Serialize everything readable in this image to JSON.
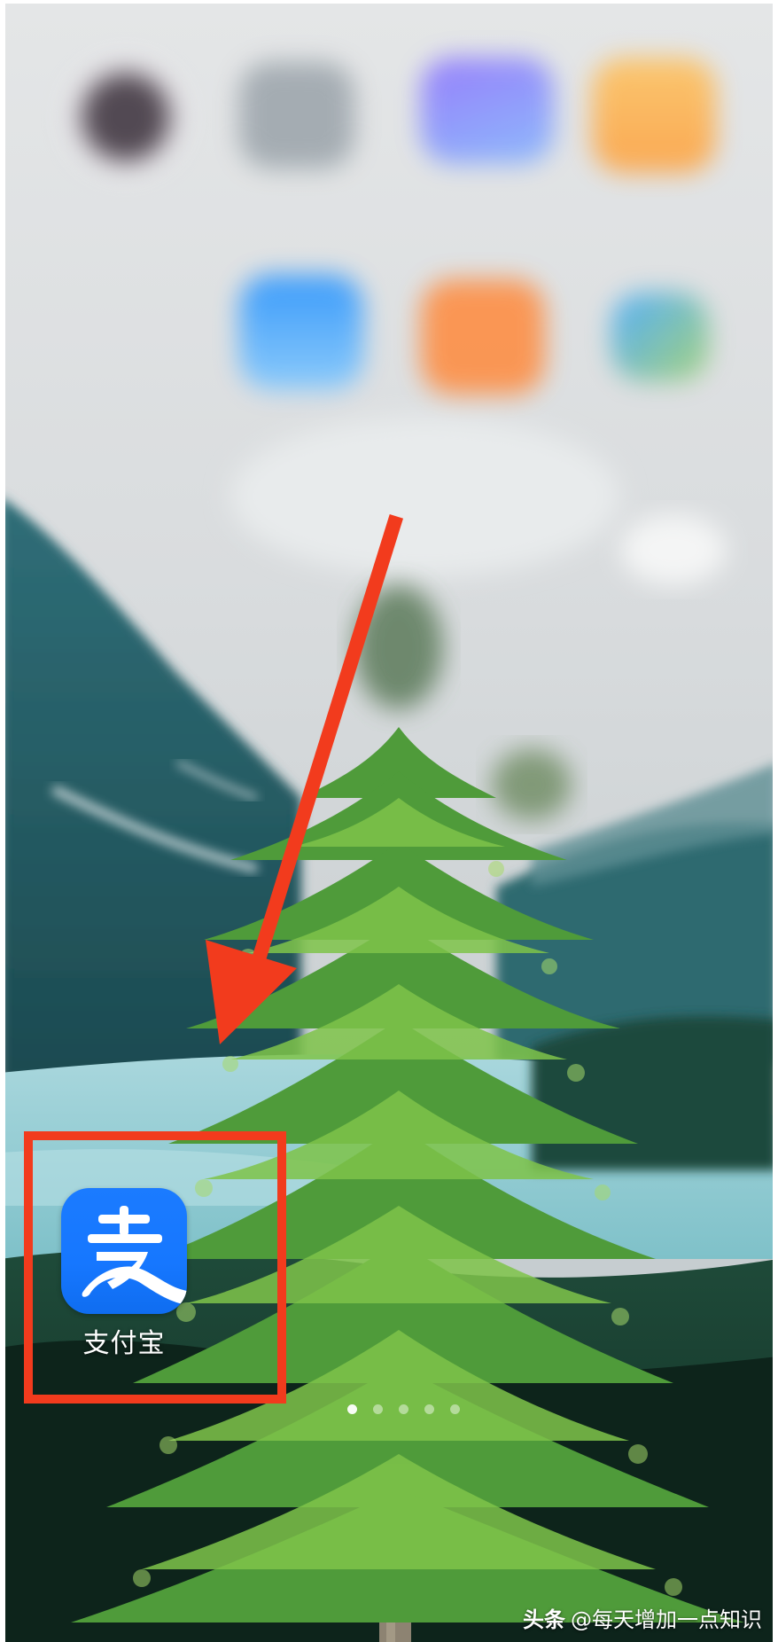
{
  "home_screen": {
    "app_icon": {
      "label": "支付宝",
      "icon_name": "alipay-icon",
      "brand_color": "#1677FF"
    },
    "blurred_apps": [
      {
        "icon_name": "camera-icon",
        "color": "#3a2f3a"
      },
      {
        "icon_name": "settings-icon",
        "color": "#9aa3aa"
      },
      {
        "icon_name": "gallery-icon",
        "color": "#8a9cff"
      },
      {
        "icon_name": "notes-icon",
        "color": "#ffb547"
      },
      {
        "icon_name": "weather-icon",
        "color": "#2f9bff"
      },
      {
        "icon_name": "app-store-icon",
        "color": "#ff8a3c"
      },
      {
        "icon_name": "play-store-icon",
        "color": "#4fb6e8"
      }
    ],
    "page_indicator": {
      "total": 5,
      "active_index": 0
    }
  },
  "annotation": {
    "arrow_color": "#F23B1D",
    "highlight_color": "#F23B1D"
  },
  "watermark": {
    "brand": "头条",
    "text": "@每天增加一点知识"
  }
}
